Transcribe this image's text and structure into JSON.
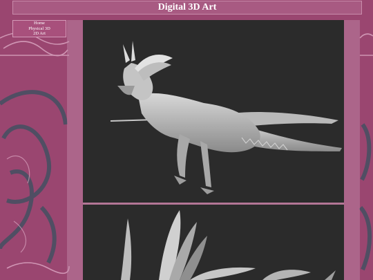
{
  "header": {
    "title": "Digital 3D Art"
  },
  "nav": {
    "items": [
      {
        "label": "Home"
      },
      {
        "label": "Physical 3D"
      },
      {
        "label": "2D Art"
      }
    ]
  },
  "colors": {
    "background": "#9a4670",
    "header": "#a85a82",
    "art_background": "#2b2b2b"
  },
  "gallery": {
    "images": [
      {
        "subject": "dragon-sculpt-side-view"
      },
      {
        "subject": "dragon-sculpt-wings-closeup"
      }
    ]
  }
}
